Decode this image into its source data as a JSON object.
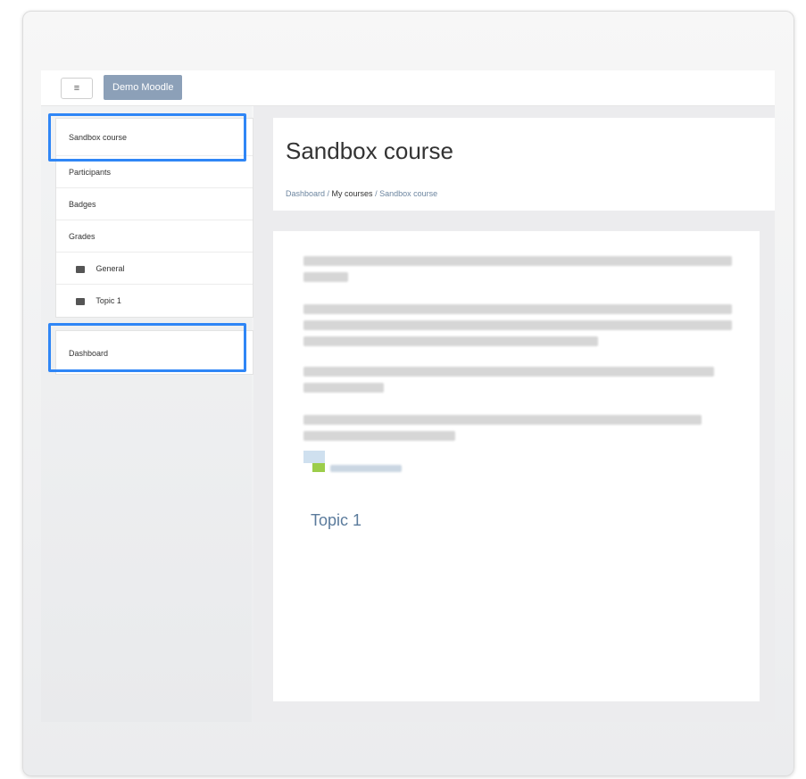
{
  "header": {
    "menu_icon": "≡",
    "brand": "Demo Moodle"
  },
  "nav": {
    "items": [
      {
        "label": "Sandbox course"
      },
      {
        "label": "Participants"
      },
      {
        "label": "Badges"
      },
      {
        "label": "Grades"
      },
      {
        "label": "General",
        "icon": "folder-icon"
      },
      {
        "label": "Topic 1",
        "icon": "folder-icon"
      }
    ],
    "dashboard": "Dashboard"
  },
  "page": {
    "title": "Sandbox course",
    "breadcrumb": {
      "dashboard": "Dashboard",
      "sep1": " / ",
      "my_courses": "My courses",
      "sep2": " / ",
      "current": "Sandbox course"
    },
    "topic_heading": "Topic 1"
  },
  "colors": {
    "highlight": "#2f86f6",
    "brand_bg": "#8ca0b8",
    "link": "#5b7b9c"
  }
}
